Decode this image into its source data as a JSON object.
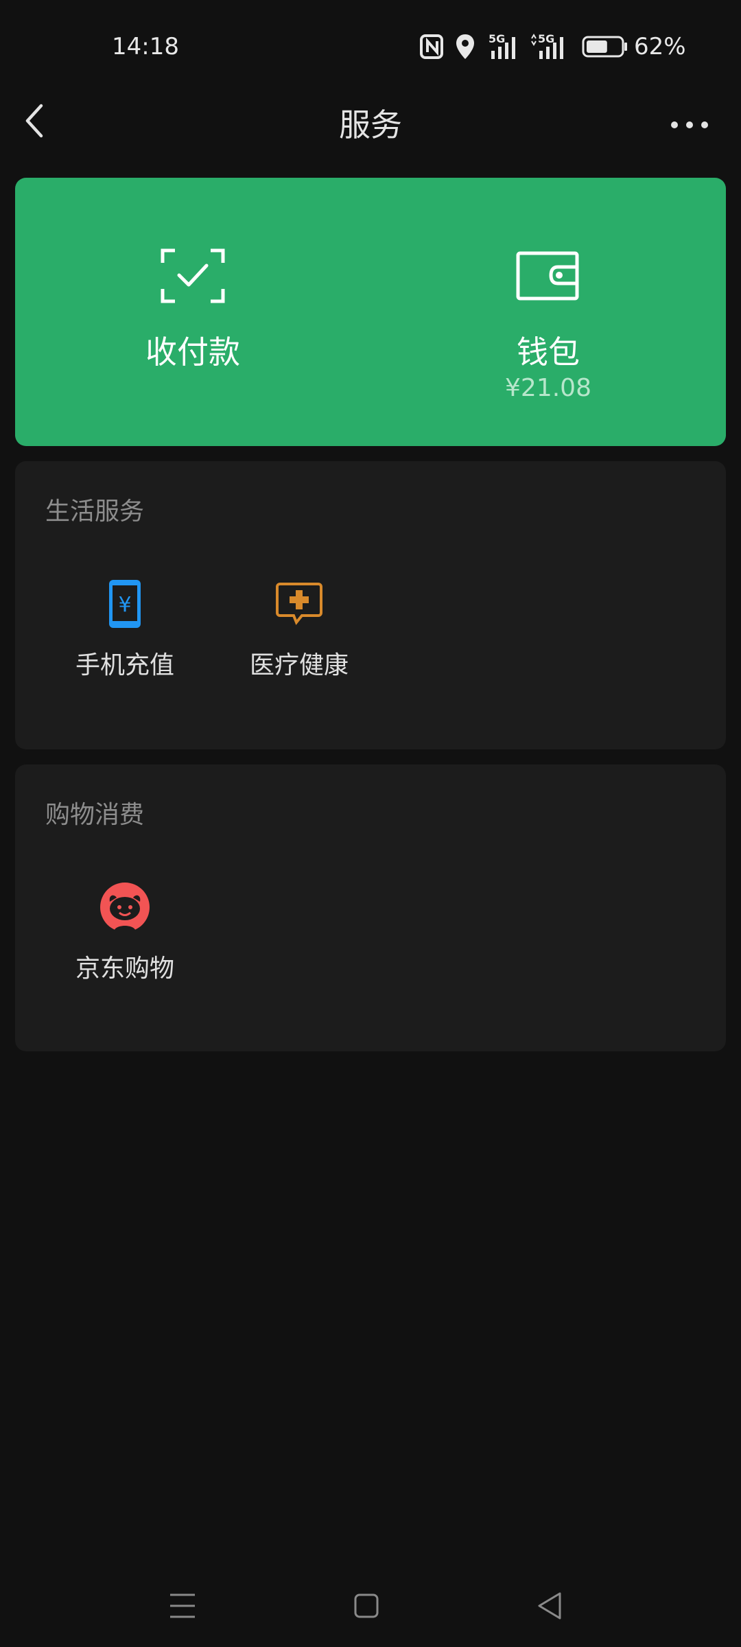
{
  "status_bar": {
    "time": "14:18",
    "battery_percent": "62%",
    "battery_level": 0.62,
    "network_labels": [
      "5G",
      "5G"
    ],
    "icons": [
      "nfc-icon",
      "location-icon",
      "signal-5g-icon",
      "signal-5g-icon",
      "battery-icon"
    ]
  },
  "header": {
    "title": "服务",
    "back_icon": "chevron-left-icon",
    "more_icon": "more-dots-icon"
  },
  "pay_card": {
    "color": "#2aad69",
    "items": [
      {
        "label": "收付款",
        "icon": "scan-check-icon"
      },
      {
        "label": "钱包",
        "sub": "¥21.08",
        "icon": "wallet-icon"
      }
    ]
  },
  "sections": [
    {
      "title": "生活服务",
      "items": [
        {
          "label": "手机充值",
          "icon": "phone-recharge-icon",
          "color": "#2196f3"
        },
        {
          "label": "医疗健康",
          "icon": "medical-health-icon",
          "color": "#d98a2b"
        }
      ]
    },
    {
      "title": "购物消费",
      "items": [
        {
          "label": "京东购物",
          "icon": "jd-shopping-icon",
          "color": "#f25454"
        }
      ]
    }
  ],
  "nav_bar": {
    "icons": [
      "menu-icon",
      "home-icon",
      "back-triangle-icon"
    ]
  }
}
